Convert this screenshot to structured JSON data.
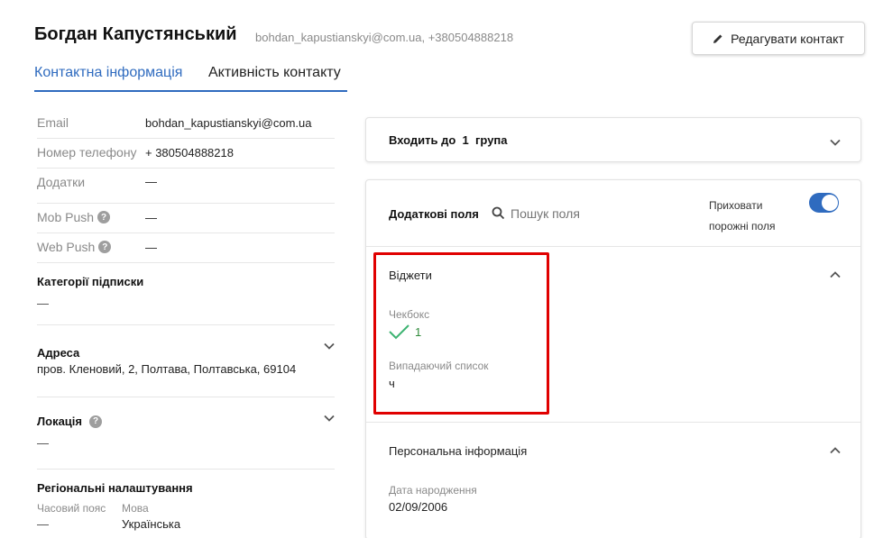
{
  "header": {
    "name": "Богдан Капустянський",
    "subinfo": "bohdan_kapustianskyi@com.ua, +380504888218",
    "edit_button": "Редагувати контакт"
  },
  "tabs": [
    {
      "label": "Контактна інформація",
      "active": true
    },
    {
      "label": "Активність контакту",
      "active": false
    }
  ],
  "contact_fields": [
    {
      "label": "Email",
      "value": "bohdan_kapustianskyi@com.ua"
    },
    {
      "label": "Номер телефону",
      "value": "+ 380504888218"
    },
    {
      "label": "Додатки",
      "value": "—"
    },
    {
      "label": "Mob Push",
      "value": "—"
    },
    {
      "label": "Web Push",
      "value": "—"
    }
  ],
  "subscription": {
    "title": "Категорії підписки",
    "value": "—"
  },
  "address": {
    "title": "Адреса",
    "value": "пров. Кленовий, 2, Полтава, Полтавська, 69104"
  },
  "location": {
    "title": "Локація",
    "value": "—"
  },
  "regional": {
    "title": "Регіональні налаштування",
    "timezone_label": "Часовий пояс",
    "timezone_value": "—",
    "language_label": "Мова",
    "language_value": "Українська"
  },
  "groups": {
    "prefix": "Входить до",
    "count": "1",
    "suffix": "група"
  },
  "extra_fields": {
    "title": "Додаткові поля",
    "search_placeholder": "Пошук поля",
    "hide_empty_line1": "Приховати",
    "hide_empty_line2": "порожні поля",
    "hide_empty_enabled": true
  },
  "widgets": {
    "title": "Віджети",
    "checkbox_label": "Чекбокс",
    "checkbox_value": "1",
    "dropdown_label": "Випадаючий список",
    "dropdown_value": "ч"
  },
  "personal": {
    "title": "Персональна інформація",
    "birthday_label": "Дата народження",
    "birthday_value": "02/09/2006"
  },
  "colors": {
    "accent": "#2f6bbf",
    "highlight": "#e00000",
    "check": "#3cb371"
  }
}
